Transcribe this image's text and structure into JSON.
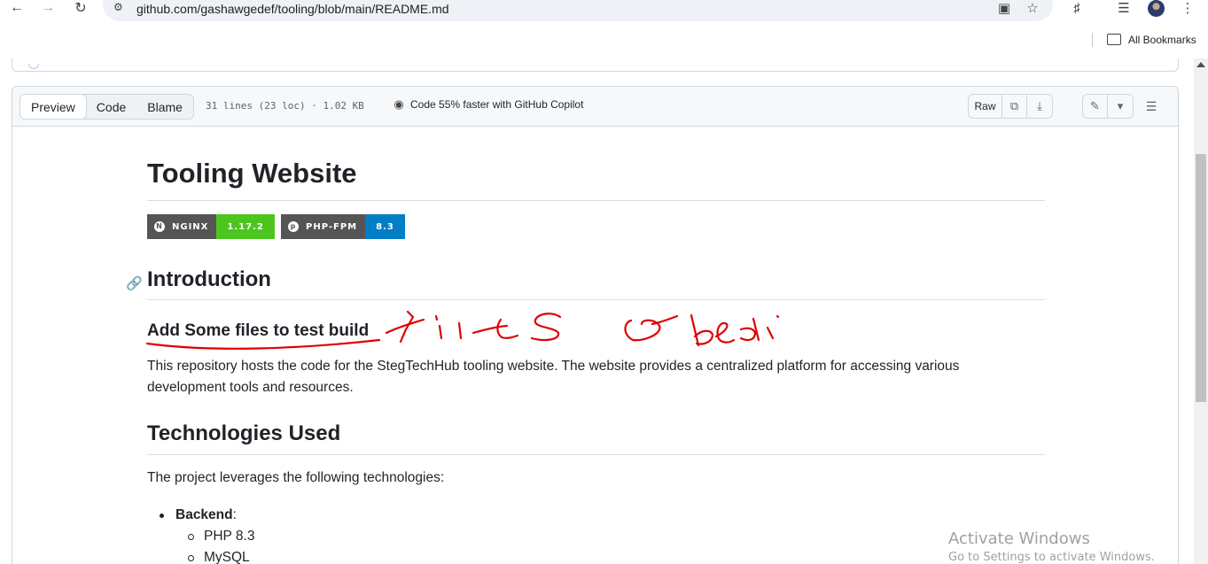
{
  "browser": {
    "url_host": "github.com",
    "url_path": "/gashawgedef/tooling/blob/main/README.md",
    "bookmarks_label": "All Bookmarks",
    "icons": [
      "back-icon",
      "forward-icon",
      "reload-icon",
      "site-info-icon",
      "install-app-icon",
      "bookmark-star-icon",
      "extensions-icon",
      "media-icon",
      "profile-avatar",
      "menu-icon",
      "folder-icon"
    ]
  },
  "file_header": {
    "tabs": [
      "Preview",
      "Code",
      "Blame"
    ],
    "active_tab": "Preview",
    "meta": "31 lines (23 loc) · 1.02 KB",
    "copilot": "Code 55% faster with GitHub Copilot",
    "raw_label": "Raw"
  },
  "readme": {
    "title": "Tooling Website",
    "badges": [
      {
        "label": "NGINX",
        "value": "1.17.2",
        "color": "#4cc61e"
      },
      {
        "label": "PHP-FPM",
        "value": "8.3",
        "color": "#007ec6"
      }
    ],
    "intro_heading": "Introduction",
    "sub_heading": "Add Some files to test build",
    "intro_text_1": "This repository hosts the code for the StegTechHub tooling website. The website provides a centralized platform for accessing various",
    "intro_text_2": "development tools and resources.",
    "tech_heading": "Technologies Used",
    "tech_text": "The project leverages the following technologies:",
    "backend_label": "Backend",
    "backend_suffix": ":",
    "backend_items": [
      "PHP 8.3",
      "MySQL"
    ]
  },
  "watermark": {
    "line1": "Activate Windows",
    "line2": "Go to Settings to activate Windows."
  },
  "colors": {
    "annotation": "#e00000",
    "link_blue": "#0969da"
  }
}
